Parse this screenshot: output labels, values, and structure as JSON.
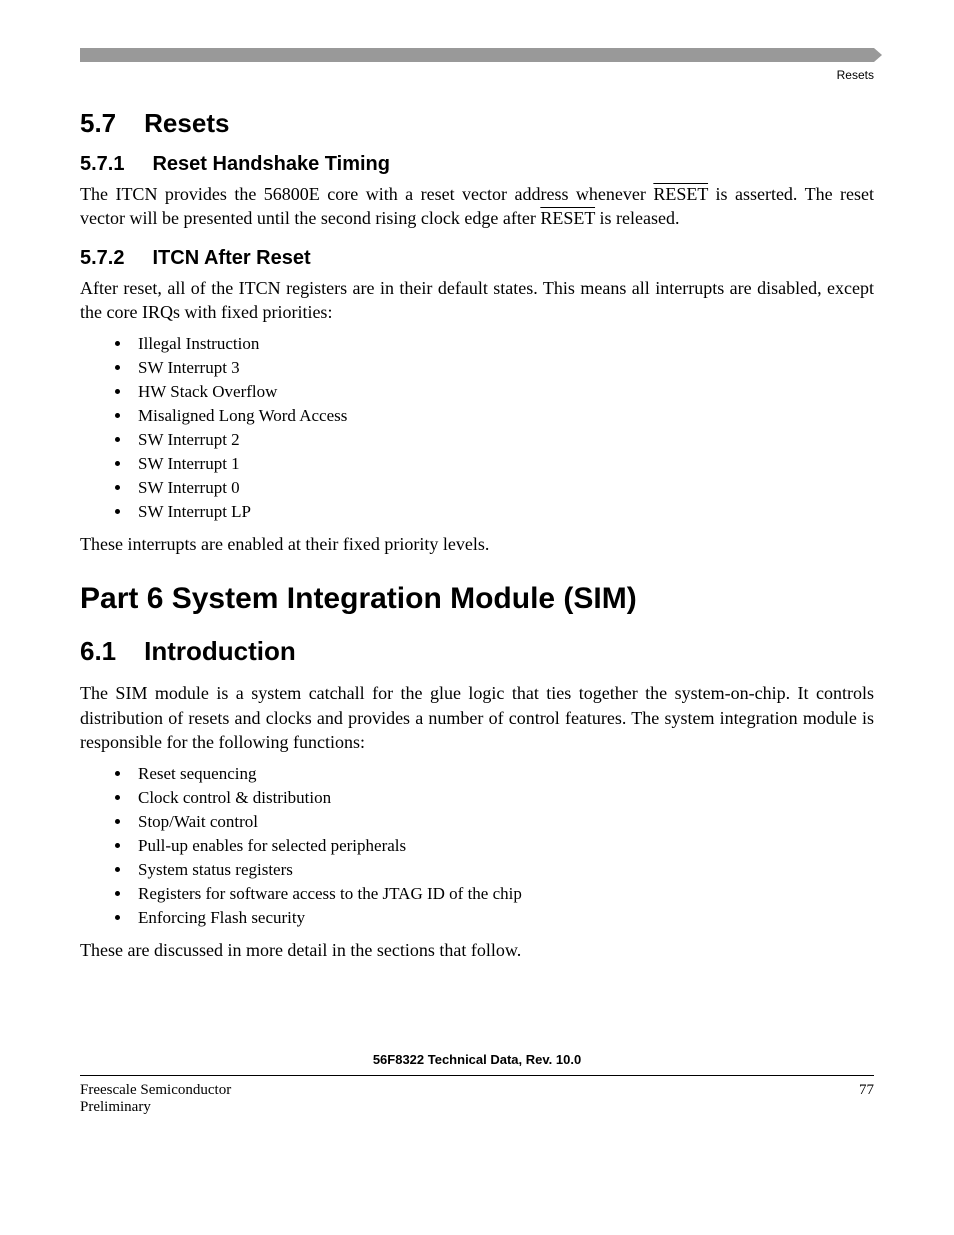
{
  "running_head": "Resets",
  "sec_5_7": {
    "num": "5.7",
    "title": "Resets"
  },
  "sec_5_7_1": {
    "num": "5.7.1",
    "title": "Reset Handshake Timing",
    "para_a": "The ITCN provides the 56800E core with a reset vector address whenever ",
    "sig1": "RESET",
    "para_b": " is asserted. The reset vector will be presented until the second rising clock edge after ",
    "sig2": "RESET",
    "para_c": " is released."
  },
  "sec_5_7_2": {
    "num": "5.7.2",
    "title": "ITCN After Reset",
    "para": "After reset, all of the ITCN registers are in their default states. This means all interrupts are disabled, except the core IRQs with fixed priorities:",
    "items": [
      "Illegal Instruction",
      "SW Interrupt 3",
      "HW Stack Overflow",
      "Misaligned Long Word Access",
      "SW Interrupt 2",
      "SW Interrupt 1",
      "SW Interrupt 0",
      "SW Interrupt LP"
    ],
    "trailer": "These interrupts are enabled at their fixed priority levels."
  },
  "part6": {
    "label": "Part 6  System Integration Module (SIM)"
  },
  "sec_6_1": {
    "num": "6.1",
    "title": "Introduction",
    "para": "The SIM module is a system catchall for the glue logic that ties together the system-on-chip. It controls distribution of resets and clocks and provides a number of control features. The system integration module is responsible for the following functions:",
    "items": [
      "Reset sequencing",
      "Clock control & distribution",
      "Stop/Wait control",
      "Pull-up enables for selected peripherals",
      "System status registers",
      "Registers for software access to the JTAG ID of the chip",
      "Enforcing Flash security"
    ],
    "trailer": "These are discussed in more detail in the sections that follow."
  },
  "footer": {
    "doc_title": "56F8322 Technical Data, Rev. 10.0",
    "company": "Freescale Semiconductor",
    "status": "Preliminary",
    "page": "77"
  }
}
